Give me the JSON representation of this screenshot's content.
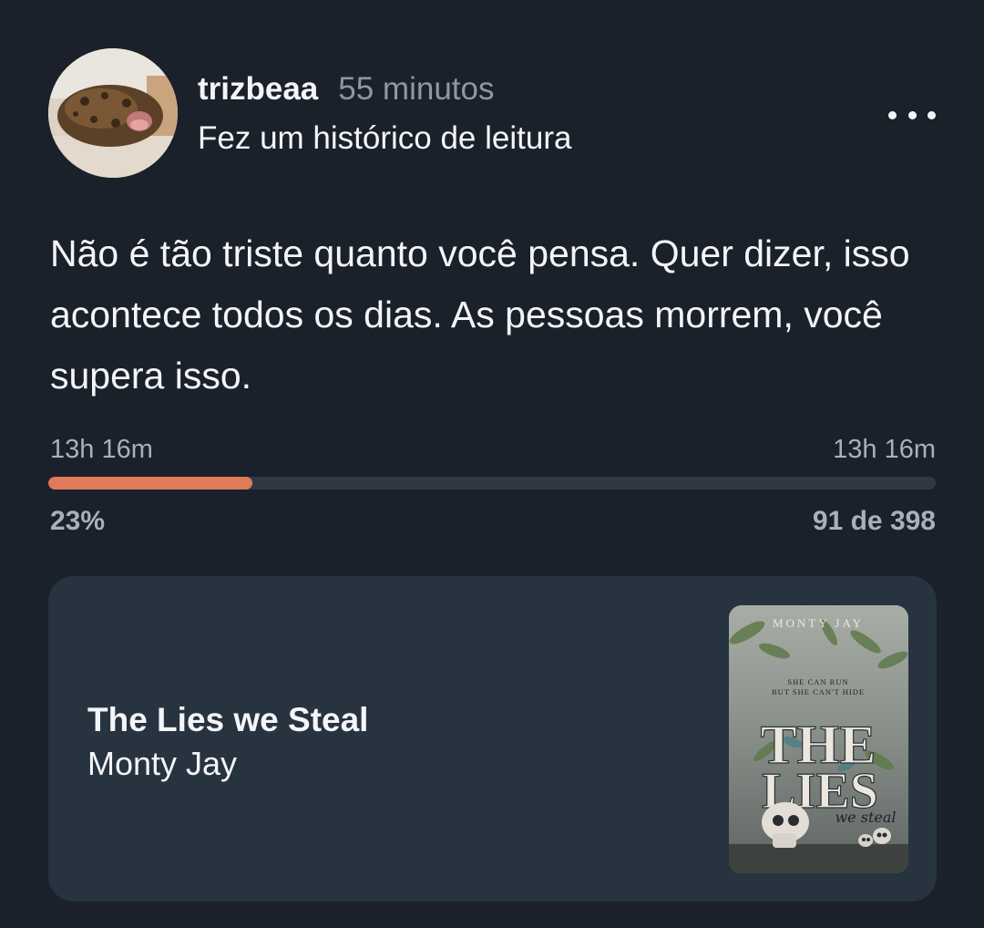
{
  "post": {
    "username": "trizbeaa",
    "time_ago": "55 minutos",
    "action": "Fez um histórico de leitura",
    "more_icon": "more-horizontal-icon"
  },
  "quote": "Não é tão triste quanto você pensa. Quer dizer, isso acontece todos os dias. As pessoas morrem, você supera isso.",
  "progress": {
    "time_left_label": "13h 16m",
    "time_right_label": "13h 16m",
    "percent_label": "23%",
    "percent": 23,
    "pages_label": "91 de 398",
    "accent": "#e07a58"
  },
  "book": {
    "title": "The Lies we Steal",
    "author": "Monty Jay",
    "cover": {
      "author_text": "MONTY JAY",
      "tagline_1": "SHE CAN RUN",
      "tagline_2": "BUT SHE CAN'T HIDE",
      "title_1": "THE",
      "title_2": "LIES",
      "title_3": "we steal"
    }
  }
}
